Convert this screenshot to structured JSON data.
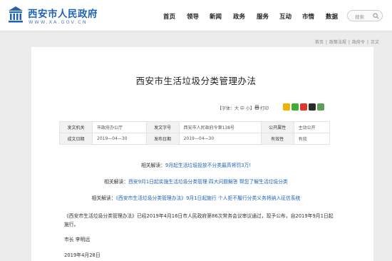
{
  "header": {
    "site_name": "西安市人民政府",
    "site_domain": "WWW.XA.GOV.CN",
    "nav": [
      "首页",
      "领导",
      "新闻",
      "政务",
      "服务",
      "互动",
      "市情",
      "数据"
    ],
    "search_placeholder": "搜索"
  },
  "breadcrumb": [
    "首页",
    "政策法规",
    "政府令",
    "正文"
  ],
  "article": {
    "title": "西安市生活垃圾分类管理办法",
    "font_size_label": "【字体：大 中 小】",
    "print_label": "打印",
    "share_icons": [
      "qzone-icon",
      "wechat-icon",
      "weibo-icon",
      "qq-icon",
      "douban-icon"
    ],
    "meta": [
      [
        "发文机关",
        "市政府办公厅",
        "发文字号",
        "西安市人民政府令第138号",
        "公开属性",
        "主动公开"
      ],
      [
        "成文日期",
        "2019—04—30",
        "发布日期",
        "2019—04—30",
        "有效性",
        "有效"
      ]
    ],
    "related": [
      {
        "label": "相关解读：",
        "link": "9月起生活垃圾投放不分类最高将罚3万!"
      },
      {
        "label": "相关解读：",
        "link": "西安9月1日起实施生活垃圾分类管理 四大问题解答 帮您了解生活垃圾分类"
      },
      {
        "label": "相关解读：",
        "link": "《西安市生活垃圾分类管理办法》9月1日起施行 个人拒不履行分类义务将纳入征信系统"
      }
    ],
    "body": "《西安市生活垃圾分类管理办法》已经2019年4月16日市人民政府第86次常务会议审议通过，现予公布，自2019年9月1日起施行。",
    "signature": "市长 李明远",
    "date": "2019年4月28日"
  },
  "colors": {
    "brand": "#1f62b8",
    "link": "#1f62b8"
  }
}
